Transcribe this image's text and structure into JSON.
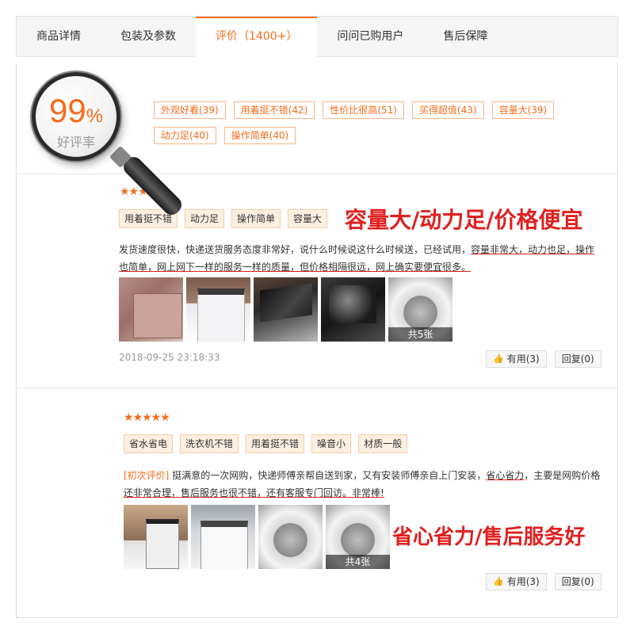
{
  "tabs": [
    {
      "label": "商品详情",
      "active": false
    },
    {
      "label": "包装及参数",
      "active": false
    },
    {
      "label": "评价（1400+）",
      "active": true
    },
    {
      "label": "问问已购用户",
      "active": false
    },
    {
      "label": "售后保障",
      "active": false
    }
  ],
  "summary": {
    "rate_number": "99",
    "rate_percent": "%",
    "rate_label": "好评率",
    "impressions": [
      "外观好看(39)",
      "用着挺不错(42)",
      "性价比很高(51)",
      "买得超值(43)",
      "容量大(39)",
      "动力足(40)",
      "操作简单(40)"
    ]
  },
  "reviews": [
    {
      "stars": "★★★★",
      "tags": [
        "用着挺不错",
        "动力足",
        "操作简单",
        "容量大"
      ],
      "text_plain_1": "发货速度很快，快递送货服务态度非常好，说什么时候说这什么时候送，已经试用，",
      "text_hl_1": "容量非常大，动力也足，操作也简单，网上网下一样的服务一样的质量，但价格相隔很远，网上确实要便宜很多。",
      "photo_count_caption": "共5张",
      "date": "2018-09-25 23:18:33",
      "useful_label": "有用(3)",
      "reply_label": "回复(0)",
      "callout": "容量大/动力足/价格便宜"
    },
    {
      "stars": "★★★★★",
      "tags": [
        "省水省电",
        "洗衣机不错",
        "用着挺不错",
        "噪音小",
        "材质一般"
      ],
      "first_label": "[初次评价]",
      "text_plain_1": " 挺满意的一次网购，快递师傅亲帮自送到家，又有安装师傅亲自上门安装，",
      "text_hl_1": "省心省力",
      "text_plain_2": "，主要是网购价格",
      "text_hl_2": "还非常合理，售后服务也很不错，还有客服专门回访。非常棒!",
      "photo_count_caption": "共4张",
      "useful_label": "有用(3)",
      "reply_label": "回复(0)",
      "callout": "省心省力/售后服务好"
    }
  ],
  "colors": {
    "accent": "#f76b1c",
    "callout": "#e02020"
  }
}
